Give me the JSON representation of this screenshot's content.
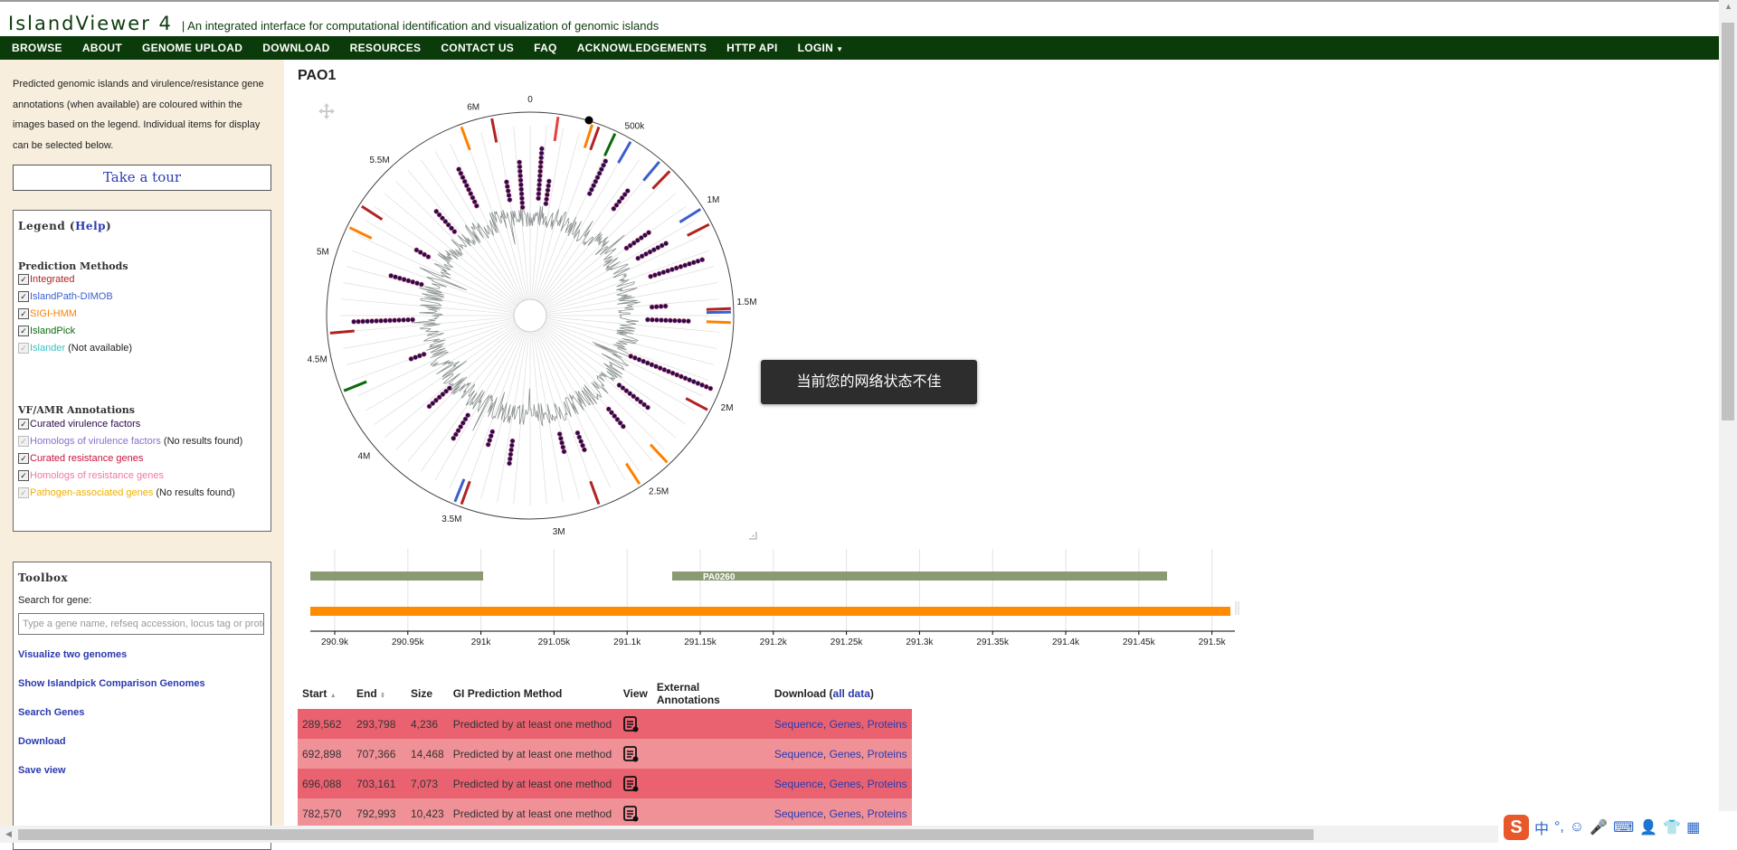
{
  "header": {
    "brand": "IslandViewer 4",
    "tagline": "| An integrated interface for computational identification and visualization of genomic islands"
  },
  "nav": [
    "BROWSE",
    "ABOUT",
    "GENOME UPLOAD",
    "DOWNLOAD",
    "RESOURCES",
    "CONTACT US",
    "FAQ",
    "ACKNOWLEDGEMENTS",
    "HTTP API",
    "LOGIN"
  ],
  "sidebar": {
    "intro": "Predicted genomic islands and virulence/resistance gene annotations (when available) are coloured within the images based on the legend. Individual items for display can be selected below.",
    "tour": "Take a tour",
    "legend": {
      "title": "Legend",
      "help_open": "(",
      "help": "Help",
      "help_close": ")",
      "methods_title": "Prediction Methods",
      "methods": [
        {
          "label": "Integrated",
          "color": "#b22222",
          "note": "",
          "enabled": true
        },
        {
          "label": "IslandPath-DIMOB",
          "color": "#3a5fcd",
          "note": "",
          "enabled": true
        },
        {
          "label": "SIGI-HMM",
          "color": "#ff8000",
          "note": "",
          "enabled": true
        },
        {
          "label": "IslandPick",
          "color": "#0b6b0b",
          "note": "",
          "enabled": true
        },
        {
          "label": "Islander",
          "color": "#40c0c0",
          "note": "(Not available)",
          "enabled": false
        }
      ],
      "annot_title": "VF/AMR Annotations",
      "annotations": [
        {
          "label": "Curated virulence factors",
          "color": "#2a0a4a",
          "note": "",
          "enabled": true
        },
        {
          "label": "Homologs of virulence factors",
          "color": "#8a6ed0",
          "note": "(No results found)",
          "enabled": false
        },
        {
          "label": "Curated resistance genes",
          "color": "#c8143c",
          "note": "",
          "enabled": true
        },
        {
          "label": "Homologs of resistance genes",
          "color": "#f07aa0",
          "note": "",
          "enabled": true
        },
        {
          "label": "Pathogen-associated genes",
          "color": "#f0b000",
          "note": "(No results found)",
          "enabled": false
        }
      ]
    },
    "toolbox": {
      "title": "Toolbox",
      "search_label": "Search for gene:",
      "search_placeholder": "Type a gene name, refseq accession, locus tag or protein",
      "links": [
        "Visualize two genomes",
        "Show Islandpick Comparison Genomes",
        "Search Genes",
        "Download",
        "Save view"
      ]
    }
  },
  "main": {
    "title": "PAO1",
    "circos_ticks": [
      "0",
      "500k",
      "1M",
      "1.5M",
      "2M",
      "2.5M",
      "3M",
      "3.5M",
      "4M",
      "4.5M",
      "5M",
      "5.5M",
      "6M"
    ],
    "toast": "当前您的网络状态不佳",
    "track": {
      "gene_label": "PA0260",
      "ticks": [
        "290.9k",
        "290.95k",
        "291k",
        "291.05k",
        "291.1k",
        "291.15k",
        "291.2k",
        "291.25k",
        "291.3k",
        "291.35k",
        "291.4k",
        "291.45k",
        "291.5k"
      ]
    },
    "table": {
      "headers": [
        "Start",
        "End",
        "Size",
        "GI Prediction Method",
        "View",
        "External Annotations",
        "Download (",
        "all data",
        ")"
      ],
      "rows": [
        {
          "start": "289,562",
          "end": "293,798",
          "size": "4,236",
          "method": "Predicted by at least one method"
        },
        {
          "start": "692,898",
          "end": "707,366",
          "size": "14,468",
          "method": "Predicted by at least one method"
        },
        {
          "start": "696,088",
          "end": "703,161",
          "size": "7,073",
          "method": "Predicted by at least one method"
        },
        {
          "start": "782,570",
          "end": "792,993",
          "size": "10,423",
          "method": "Predicted by at least one method"
        }
      ],
      "download_links": [
        "Sequence",
        "Genes",
        "Proteins"
      ]
    }
  },
  "ime": {
    "lang": "中"
  }
}
